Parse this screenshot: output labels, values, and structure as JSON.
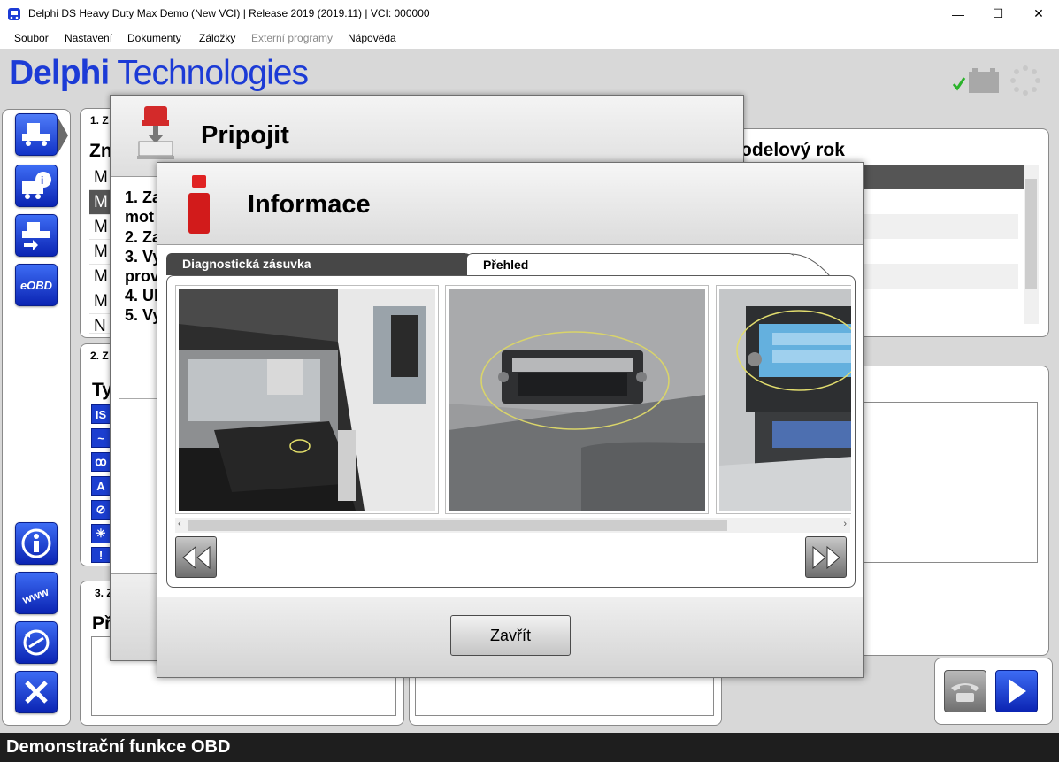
{
  "window": {
    "title": "Delphi DS Heavy Duty Max Demo (New VCI) | Release 2019 (2019.11)  |  VCI: 000000",
    "controls": {
      "minimize": "—",
      "maximize": "☐",
      "close": "✕"
    }
  },
  "menu": [
    {
      "label": "Soubor",
      "enabled": true
    },
    {
      "label": "Nastavení",
      "enabled": true
    },
    {
      "label": "Dokumenty",
      "enabled": true
    },
    {
      "label": "Záložky",
      "enabled": true
    },
    {
      "label": "Externí programy",
      "enabled": false
    },
    {
      "label": "Nápověda",
      "enabled": true
    }
  ],
  "logo": {
    "bold": "Delphi",
    "light": " Technologies"
  },
  "panels": {
    "manufacturer": {
      "step": "1. Z",
      "heading": "Zn",
      "rows": [
        "M",
        "M",
        "M",
        "M",
        "M",
        "M",
        "N"
      ]
    },
    "systems": {
      "step": "2. Z",
      "heading": "Ty",
      "icons": [
        "IS",
        "~",
        "ꝏ",
        "A",
        "⊘",
        "✳",
        "!"
      ]
    },
    "vehicle": {
      "step": "3. Z",
      "heading": "Př"
    },
    "model_year": {
      "heading": "odelový rok"
    }
  },
  "dialog_connect": {
    "title": "Pripojit",
    "steps": [
      "1. Za",
      "mot",
      "2. Za",
      "3. Vy",
      "prov",
      "4. Ul",
      "5. Vy"
    ]
  },
  "dialog_info": {
    "title": "Informace",
    "tabs": [
      "Diagnostická zásuvka",
      "Přehled"
    ],
    "close_label": "Zavřít",
    "scroll_left": "‹",
    "scroll_right": "›"
  },
  "status_bar": {
    "text": "Demonstrační funkce OBD"
  },
  "colors": {
    "brand": "#1c3bd6",
    "button_blue": "#1233c7",
    "status_bar": "#1e1e1e",
    "selected_row": "#555555",
    "check": "#2bb32b"
  }
}
